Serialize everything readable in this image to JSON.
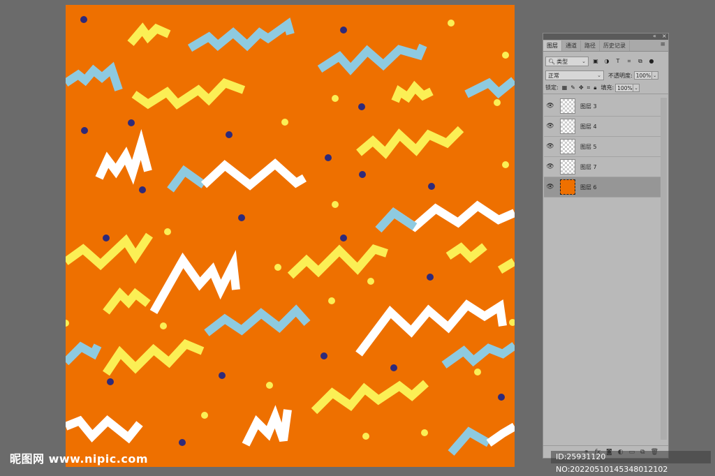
{
  "canvas": {
    "background_color": "#ee7000",
    "colors": {
      "blue": "#8ecae0",
      "yellow": "#fbef55",
      "white": "#ffffff",
      "dot_navy": "#2e2a7a",
      "dot_yellow": "#fbef55"
    }
  },
  "panel": {
    "collapse_glyph": "«",
    "close_glyph": "×",
    "tabs": [
      "图层",
      "通道",
      "路径",
      "历史记录"
    ],
    "active_tab": 0,
    "menu_icon": "hamburger-icon",
    "filter": {
      "value": "类型",
      "icon": "search-icon"
    },
    "blend_mode": "正常",
    "opacity_label": "不透明度:",
    "opacity_value": "100%",
    "lock_label": "锁定:",
    "fill_label": "填充:",
    "fill_value": "100%",
    "layers": [
      {
        "name": "图层 3",
        "visible": true,
        "selected": false,
        "thumb": "transparent"
      },
      {
        "name": "图层 4",
        "visible": true,
        "selected": false,
        "thumb": "transparent"
      },
      {
        "name": "图层 5",
        "visible": true,
        "selected": false,
        "thumb": "transparent"
      },
      {
        "name": "图层 7",
        "visible": true,
        "selected": false,
        "thumb": "transparent"
      },
      {
        "name": "图层 6",
        "visible": true,
        "selected": true,
        "thumb": "fill"
      }
    ]
  },
  "watermark": {
    "site": "昵图网 www.nipic.com",
    "id_text": "ID:25931120 NO:20220510145348012102"
  }
}
